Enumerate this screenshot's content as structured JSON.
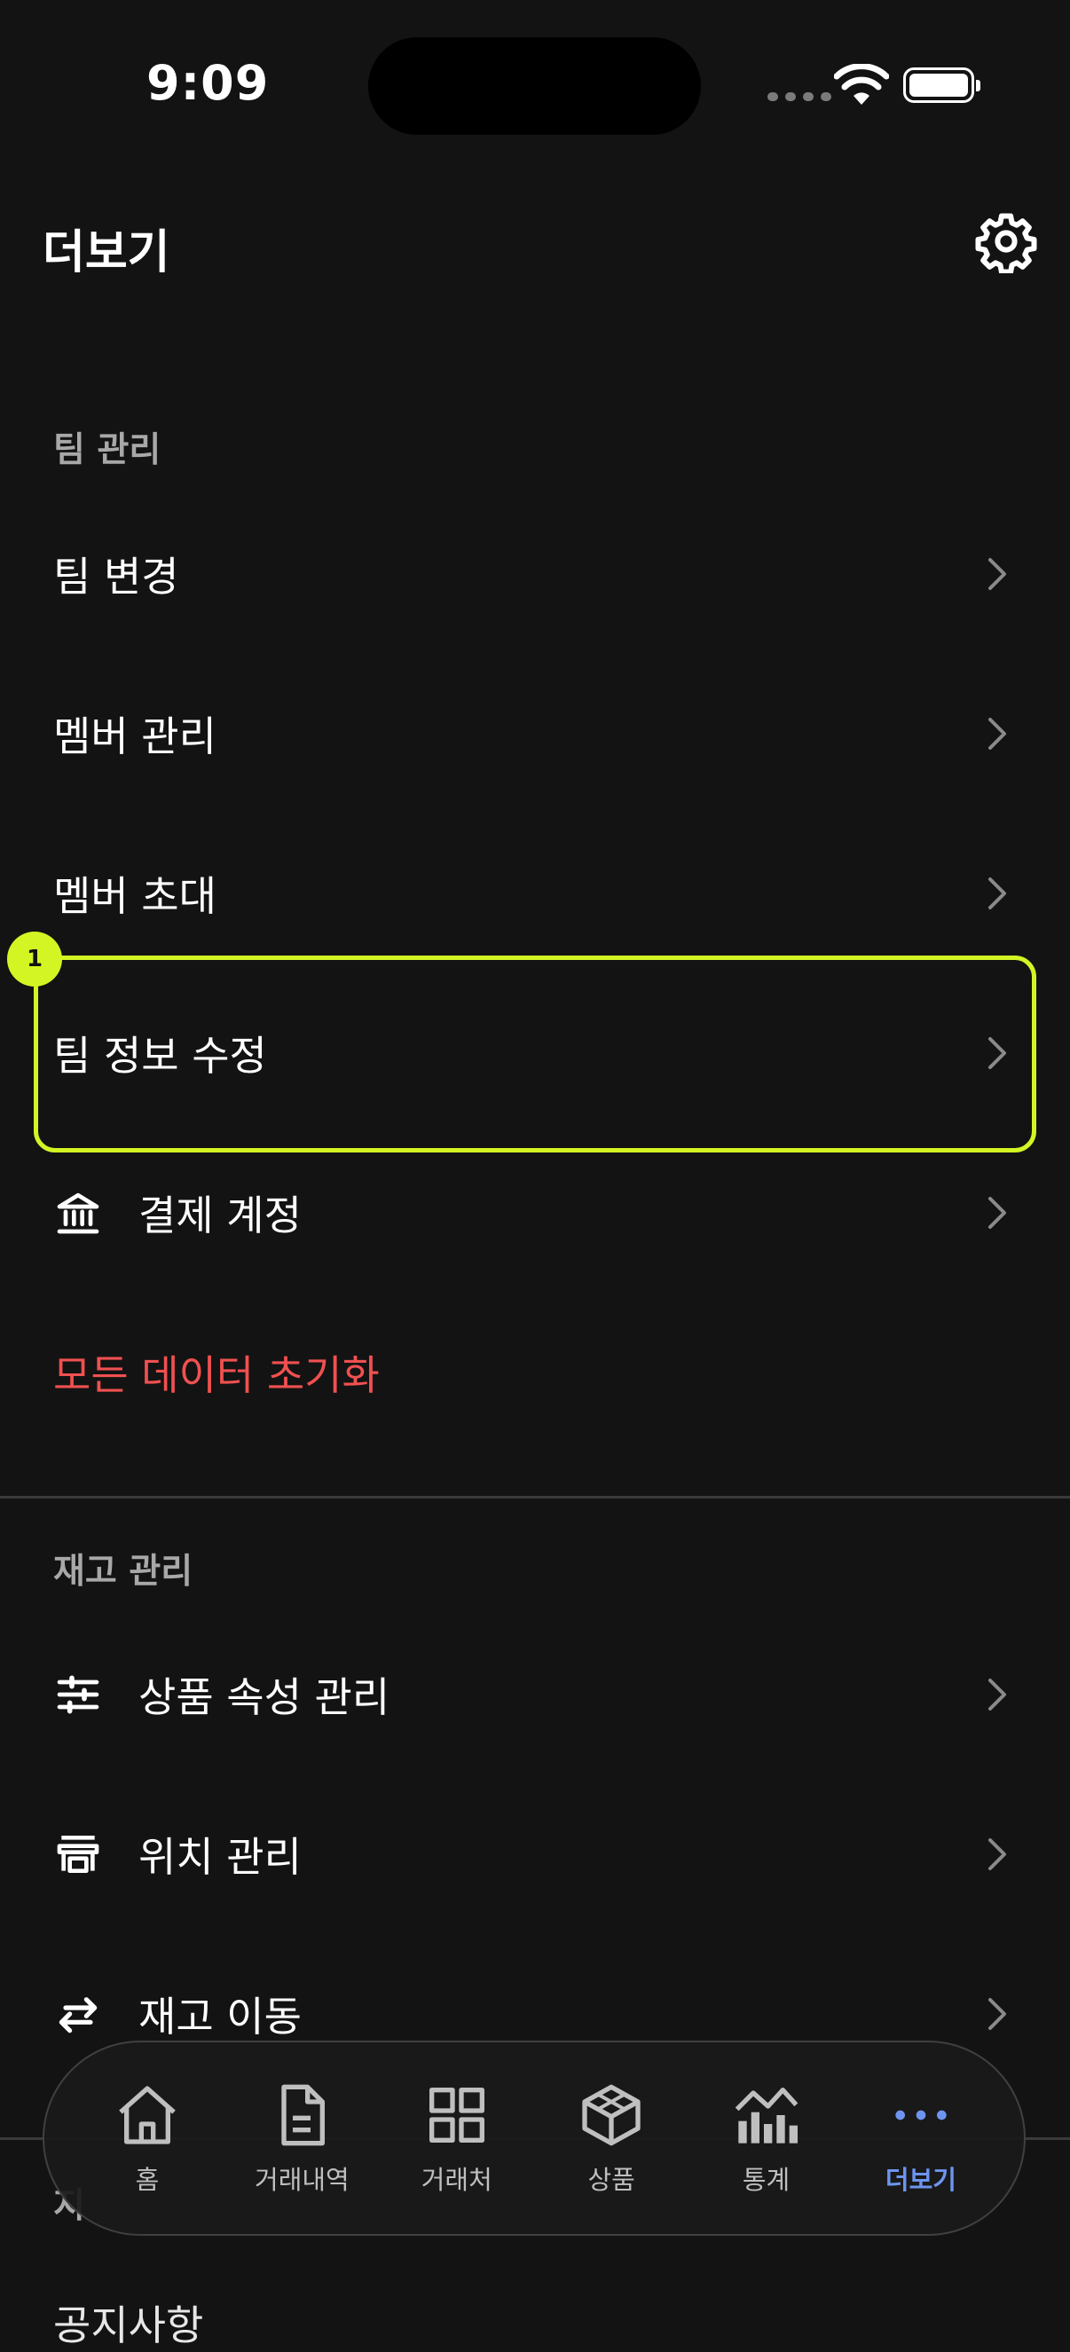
{
  "status_bar": {
    "time": "9:09"
  },
  "header": {
    "title": "더보기",
    "settings_icon": "gear-icon"
  },
  "sections": [
    {
      "title": "팀 관리",
      "items": [
        {
          "label": "팀 변경"
        },
        {
          "label": "멤버 관리"
        },
        {
          "label": "멤버 초대"
        },
        {
          "label": "팀 정보 수정"
        },
        {
          "label": "결제 계정",
          "icon": "bank-icon"
        },
        {
          "label": "모든 데이터 초기화",
          "style": "danger"
        }
      ]
    },
    {
      "title": "재고 관리",
      "items": [
        {
          "label": "상품 속성 관리",
          "icon": "sliders-icon"
        },
        {
          "label": "위치 관리",
          "icon": "store-icon"
        },
        {
          "label": "재고 이동",
          "icon": "transfer-icon"
        }
      ]
    },
    {
      "title": "지",
      "items": [
        {
          "label": "공지사항"
        }
      ]
    }
  ],
  "highlight": {
    "badge": "1"
  },
  "tabbar": {
    "active": "더보기",
    "tabs": [
      {
        "label": "홈",
        "icon": "home-icon"
      },
      {
        "label": "거래내역",
        "icon": "document-icon"
      },
      {
        "label": "거래처",
        "icon": "grid-icon"
      },
      {
        "label": "상품",
        "icon": "box-icon"
      },
      {
        "label": "통계",
        "icon": "chart-icon"
      },
      {
        "label": "더보기",
        "icon": "more-icon"
      }
    ]
  },
  "colors": {
    "background": "#131313",
    "accent": "#6d95f0",
    "danger": "#f05050",
    "highlight": "#d4f524"
  }
}
